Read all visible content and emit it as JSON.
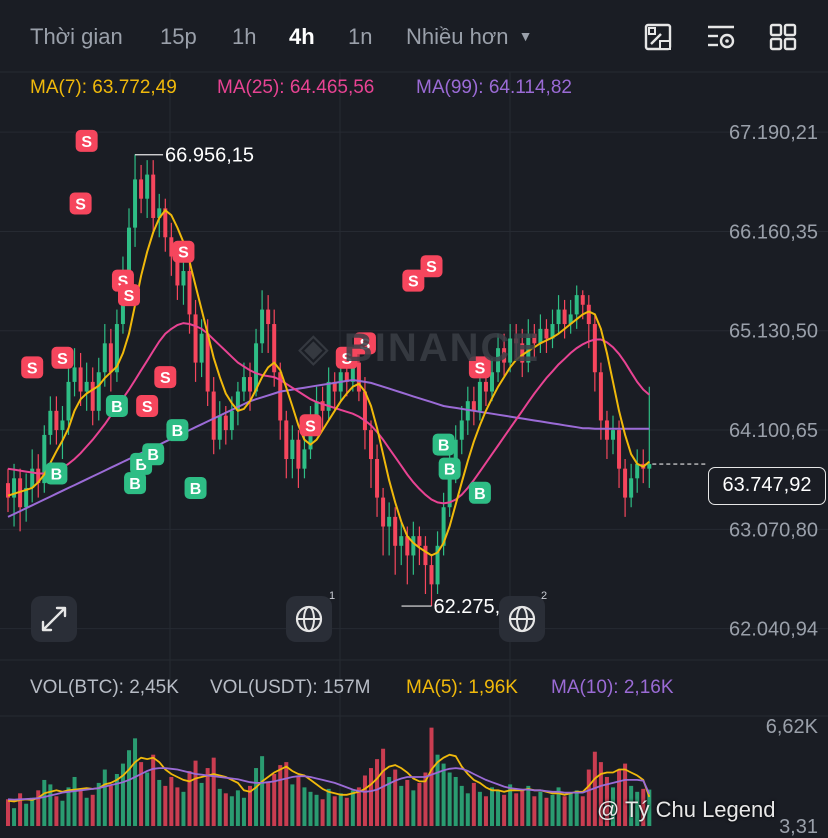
{
  "toolbar": {
    "timeframes": [
      "Thời gian",
      "15p",
      "1h",
      "4h",
      "1n",
      "Nhiều hơn"
    ],
    "active_timeframe": "4h",
    "icons": [
      "drawing-tools-icon",
      "indicator-settings-icon",
      "layout-grid-icon"
    ]
  },
  "legend": {
    "ma7": "MA(7): 63.772,49",
    "ma25": "MA(25): 64.465,56",
    "ma99": "MA(99): 64.114,82"
  },
  "volume_legend": {
    "vol_btc": "VOL(BTC): 2,45K",
    "vol_usdt": "VOL(USDT): 157M",
    "ma5": "MA(5): 1,96K",
    "ma10": "MA(10): 2,16K"
  },
  "colors": {
    "up": "#2ebd85",
    "down": "#f6465d",
    "ma7": "#f0b90b",
    "ma25": "#e84393",
    "ma99": "#9b6bd6",
    "background": "#1a1d24",
    "grid": "#262a32"
  },
  "watermark": {
    "brand": "BINANCE",
    "user": "@ Tý Chu Legend"
  },
  "current_price": "63.747,92",
  "event_badges": [
    "1",
    "2"
  ],
  "chart_data": {
    "type": "candlestick",
    "y_axis_ticks": [
      "67.190,21",
      "66.160,35",
      "65.130,50",
      "64.100,65",
      "63.070,80",
      "62.040,94"
    ],
    "ylim": [
      61840,
      67420
    ],
    "high_annotation": "66.956,15",
    "low_annotation": "62.275,00",
    "volume_axis_ticks": [
      "6,62K",
      "3,31"
    ],
    "vol_ylim": [
      0,
      7000
    ],
    "grid": true,
    "candles": [
      [
        63550,
        63400,
        63700,
        63250
      ],
      [
        63400,
        63600,
        63750,
        63100
      ],
      [
        63600,
        63300,
        63700,
        63050
      ],
      [
        63300,
        63500,
        63650,
        63150
      ],
      [
        63500,
        63700,
        63900,
        63350
      ],
      [
        63700,
        63550,
        63850,
        63400
      ],
      [
        63550,
        64050,
        64150,
        63450
      ],
      [
        64050,
        64300,
        64450,
        63950
      ],
      [
        64300,
        64100,
        64450,
        63950
      ],
      [
        64100,
        64200,
        64350,
        63800
      ],
      [
        64200,
        64600,
        64750,
        64050
      ],
      [
        64600,
        64750,
        64950,
        64450
      ],
      [
        64750,
        64500,
        64900,
        64350
      ],
      [
        64500,
        64600,
        64800,
        64300
      ],
      [
        64600,
        64300,
        64750,
        64150
      ],
      [
        64300,
        64700,
        64850,
        64200
      ],
      [
        64700,
        65000,
        65200,
        64550
      ],
      [
        65000,
        64700,
        65150,
        64500
      ],
      [
        64700,
        65200,
        65350,
        64600
      ],
      [
        65200,
        65700,
        65900,
        65100
      ],
      [
        65700,
        66200,
        66400,
        65500
      ],
      [
        66200,
        66700,
        66960,
        66000
      ],
      [
        66700,
        66500,
        66850,
        66350
      ],
      [
        66500,
        66750,
        66900,
        66300
      ],
      [
        66750,
        66300,
        66900,
        66150
      ],
      [
        66300,
        66400,
        66550,
        66100
      ],
      [
        66400,
        66100,
        66500,
        65950
      ],
      [
        66100,
        65900,
        66250,
        65700
      ],
      [
        65900,
        65600,
        66050,
        65450
      ],
      [
        65600,
        65750,
        65900,
        65400
      ],
      [
        65750,
        65300,
        65900,
        65100
      ],
      [
        65300,
        64800,
        65450,
        64600
      ],
      [
        64800,
        65100,
        65250,
        64650
      ],
      [
        65100,
        64500,
        65250,
        64350
      ],
      [
        64500,
        64000,
        64650,
        63850
      ],
      [
        64000,
        64250,
        64400,
        63900
      ],
      [
        64250,
        64100,
        64350,
        63950
      ],
      [
        64100,
        64300,
        64450,
        64000
      ],
      [
        64300,
        64500,
        64600,
        64150
      ],
      [
        64500,
        64650,
        64800,
        64400
      ],
      [
        64650,
        64500,
        64800,
        64300
      ],
      [
        64500,
        65000,
        65150,
        64450
      ],
      [
        65000,
        65350,
        65550,
        64900
      ],
      [
        65350,
        65200,
        65500,
        64900
      ],
      [
        65200,
        64700,
        65350,
        64550
      ],
      [
        64700,
        64200,
        64800,
        64000
      ],
      [
        64200,
        63800,
        64300,
        63600
      ],
      [
        63800,
        64000,
        64150,
        63600
      ],
      [
        64000,
        63700,
        64100,
        63500
      ],
      [
        63700,
        63900,
        64100,
        63600
      ],
      [
        63900,
        64200,
        64350,
        63800
      ],
      [
        64200,
        64400,
        64550,
        64050
      ],
      [
        64400,
        64300,
        64550,
        64100
      ],
      [
        64300,
        64600,
        64750,
        64200
      ],
      [
        64600,
        64500,
        64700,
        64300
      ],
      [
        64500,
        64700,
        64850,
        64400
      ],
      [
        64700,
        64600,
        64850,
        64450
      ],
      [
        64600,
        64800,
        64950,
        64500
      ],
      [
        64800,
        64500,
        64950,
        64400
      ],
      [
        64500,
        64100,
        64650,
        63900
      ],
      [
        64100,
        63800,
        64200,
        63500
      ],
      [
        63800,
        63400,
        63950,
        63200
      ],
      [
        63400,
        63100,
        63500,
        62800
      ],
      [
        63100,
        63200,
        63350,
        62800
      ],
      [
        63200,
        62900,
        63300,
        62600
      ],
      [
        62900,
        63000,
        63150,
        62700
      ],
      [
        63000,
        62800,
        63100,
        62500
      ],
      [
        62800,
        63000,
        63150,
        62600
      ],
      [
        63000,
        62900,
        63100,
        62700
      ],
      [
        62900,
        62700,
        63000,
        62400
      ],
      [
        62700,
        62500,
        62800,
        62275
      ],
      [
        62500,
        62900,
        63050,
        62400
      ],
      [
        62900,
        63300,
        63450,
        62800
      ],
      [
        63300,
        63700,
        63850,
        63200
      ],
      [
        63700,
        64000,
        64150,
        63550
      ],
      [
        64000,
        64200,
        64350,
        63850
      ],
      [
        64200,
        64400,
        64550,
        64050
      ],
      [
        64400,
        64300,
        64550,
        64150
      ],
      [
        64300,
        64600,
        64750,
        64200
      ],
      [
        64600,
        64500,
        64700,
        64350
      ],
      [
        64500,
        64700,
        64850,
        64400
      ],
      [
        64700,
        64950,
        65100,
        64600
      ],
      [
        64950,
        64800,
        65100,
        64650
      ],
      [
        64800,
        65050,
        65200,
        64700
      ],
      [
        65050,
        65000,
        65200,
        64850
      ],
      [
        65000,
        64800,
        65150,
        64650
      ],
      [
        64800,
        65100,
        65250,
        64700
      ],
      [
        65100,
        65000,
        65200,
        64850
      ],
      [
        65000,
        65150,
        65300,
        64900
      ],
      [
        65150,
        65050,
        65250,
        64900
      ],
      [
        65050,
        65200,
        65350,
        64950
      ],
      [
        65200,
        65350,
        65500,
        65100
      ],
      [
        65350,
        65200,
        65450,
        65050
      ],
      [
        65200,
        65300,
        65450,
        65100
      ],
      [
        65300,
        65500,
        65600,
        65150
      ],
      [
        65500,
        65400,
        65550,
        65250
      ],
      [
        65400,
        65200,
        65500,
        64950
      ],
      [
        65200,
        64700,
        65300,
        64500
      ],
      [
        64700,
        64200,
        64800,
        64000
      ],
      [
        64200,
        64000,
        64300,
        63800
      ],
      [
        64000,
        64100,
        64250,
        63850
      ],
      [
        64100,
        63700,
        64200,
        63500
      ],
      [
        63700,
        63400,
        63800,
        63200
      ],
      [
        63400,
        63600,
        63750,
        63300
      ],
      [
        63600,
        63750,
        63900,
        63450
      ],
      [
        63750,
        63700,
        63900,
        63550
      ],
      [
        63700,
        63748,
        64550,
        63500
      ]
    ],
    "ma7": [
      63420,
      63440,
      63460,
      63480,
      63500,
      63560,
      63640,
      63760,
      63880,
      63990,
      64120,
      64300,
      64420,
      64480,
      64520,
      64560,
      64640,
      64700,
      64760,
      64900,
      65100,
      65400,
      65700,
      65950,
      66150,
      66300,
      66380,
      66330,
      66200,
      66050,
      65850,
      65600,
      65350,
      65100,
      64850,
      64650,
      64480,
      64380,
      64300,
      64320,
      64400,
      64520,
      64650,
      64750,
      64800,
      64720,
      64540,
      64350,
      64150,
      64000,
      63950,
      64000,
      64100,
      64200,
      64300,
      64400,
      64480,
      64550,
      64580,
      64500,
      64350,
      64120,
      63850,
      63580,
      63350,
      63150,
      63000,
      62930,
      62880,
      62840,
      62800,
      62830,
      62930,
      63100,
      63330,
      63560,
      63780,
      63980,
      64150,
      64300,
      64430,
      64550,
      64650,
      64750,
      64830,
      64880,
      64920,
      64960,
      65000,
      65030,
      65060,
      65100,
      65150,
      65200,
      65250,
      65300,
      65330,
      65300,
      65150,
      64900,
      64600,
      64300,
      64050,
      63850,
      63750,
      63720,
      63772
    ],
    "ma25": [
      63700,
      63690,
      63680,
      63670,
      63660,
      63650,
      63650,
      63660,
      63680,
      63710,
      63750,
      63800,
      63860,
      63930,
      64000,
      64080,
      64160,
      64250,
      64340,
      64430,
      64520,
      64620,
      64720,
      64820,
      64920,
      65020,
      65100,
      65150,
      65190,
      65210,
      65200,
      65180,
      65150,
      65100,
      65040,
      64980,
      64920,
      64860,
      64800,
      64760,
      64720,
      64690,
      64670,
      64660,
      64650,
      64620,
      64580,
      64540,
      64500,
      64460,
      64420,
      64390,
      64370,
      64350,
      64330,
      64310,
      64290,
      64270,
      64240,
      64200,
      64150,
      64080,
      64000,
      63910,
      63820,
      63730,
      63640,
      63560,
      63490,
      63430,
      63380,
      63350,
      63340,
      63350,
      63380,
      63430,
      63500,
      63580,
      63670,
      63760,
      63850,
      63940,
      64030,
      64120,
      64210,
      64300,
      64390,
      64480,
      64560,
      64640,
      64710,
      64780,
      64840,
      64900,
      64950,
      64990,
      65020,
      65040,
      65040,
      65010,
      64960,
      64890,
      64800,
      64700,
      64600,
      64520,
      64466
    ],
    "ma99": [
      63200,
      63230,
      63260,
      63290,
      63320,
      63350,
      63380,
      63410,
      63440,
      63470,
      63500,
      63530,
      63560,
      63590,
      63620,
      63650,
      63680,
      63710,
      63740,
      63770,
      63800,
      63830,
      63860,
      63890,
      63920,
      63950,
      63980,
      64010,
      64040,
      64070,
      64100,
      64130,
      64160,
      64190,
      64220,
      64250,
      64280,
      64310,
      64340,
      64370,
      64400,
      64420,
      64440,
      64460,
      64480,
      64500,
      64510,
      64520,
      64530,
      64540,
      64550,
      64560,
      64570,
      64580,
      64590,
      64600,
      64610,
      64620,
      64610,
      64600,
      64590,
      64570,
      64550,
      64530,
      64510,
      64490,
      64470,
      64450,
      64430,
      64410,
      64390,
      64370,
      64350,
      64340,
      64330,
      64320,
      64310,
      64300,
      64290,
      64280,
      64270,
      64260,
      64250,
      64240,
      64230,
      64220,
      64210,
      64200,
      64190,
      64180,
      64170,
      64160,
      64150,
      64140,
      64130,
      64120,
      64120,
      64115,
      64115,
      64115,
      64115,
      64115,
      64115,
      64115,
      64115,
      64115,
      64115
    ],
    "volumes": [
      1800,
      1200,
      2200,
      1500,
      1900,
      2400,
      3100,
      2800,
      2000,
      1700,
      2600,
      3300,
      2500,
      1900,
      2100,
      2900,
      3800,
      2700,
      3500,
      4200,
      5100,
      5900,
      4300,
      3600,
      4800,
      3100,
      2700,
      3300,
      2600,
      2300,
      3700,
      4400,
      2900,
      3900,
      4600,
      2500,
      2200,
      2000,
      2400,
      1900,
      2700,
      3900,
      4700,
      3000,
      3500,
      4100,
      4300,
      2800,
      3300,
      2600,
      2300,
      2100,
      1800,
      2500,
      2000,
      2200,
      1900,
      2400,
      2600,
      3400,
      3900,
      4500,
      5200,
      3300,
      3800,
      2700,
      3100,
      2400,
      2900,
      3600,
      6620,
      4800,
      4200,
      3600,
      3300,
      2700,
      2200,
      2900,
      2300,
      2000,
      2600,
      2400,
      2100,
      2800,
      2200,
      2500,
      2700,
      2000,
      2300,
      1900,
      2100,
      2600,
      2000,
      2200,
      2400,
      2000,
      3800,
      5000,
      4300,
      3300,
      2600,
      3800,
      4200,
      2700,
      2300,
      2500,
      2450
    ],
    "vol_ma5": [
      1700,
      1650,
      1750,
      1800,
      1750,
      1900,
      2200,
      2300,
      2400,
      2300,
      2400,
      2450,
      2500,
      2550,
      2500,
      2550,
      2800,
      2900,
      3100,
      3400,
      3800,
      4300,
      4600,
      4500,
      4600,
      4300,
      3800,
      3500,
      3300,
      3100,
      3000,
      3200,
      3300,
      3400,
      3500,
      3400,
      3300,
      3100,
      2900,
      2400,
      2300,
      2600,
      3000,
      3300,
      3600,
      3800,
      4000,
      3700,
      3500,
      3400,
      3100,
      2800,
      2500,
      2300,
      2200,
      2100,
      2100,
      2200,
      2300,
      2500,
      2800,
      3200,
      3700,
      4000,
      4100,
      3900,
      3600,
      3200,
      3000,
      3000,
      3800,
      4300,
      4600,
      4800,
      4700,
      4000,
      3500,
      3100,
      2900,
      2600,
      2400,
      2400,
      2300,
      2400,
      2400,
      2400,
      2500,
      2400,
      2400,
      2300,
      2200,
      2200,
      2100,
      2200,
      2300,
      2300,
      2700,
      3200,
      3500,
      3600,
      3600,
      3800,
      3800,
      3600,
      3400,
      3100,
      1960
    ],
    "vol_ma10": [
      1800,
      1780,
      1800,
      1820,
      1840,
      1880,
      1950,
      2050,
      2150,
      2250,
      2300,
      2350,
      2400,
      2450,
      2500,
      2550,
      2650,
      2750,
      2850,
      2950,
      3100,
      3300,
      3500,
      3700,
      3850,
      3900,
      3900,
      3850,
      3800,
      3700,
      3600,
      3500,
      3450,
      3400,
      3350,
      3300,
      3250,
      3200,
      3150,
      3050,
      2950,
      2900,
      2900,
      2950,
      3000,
      3100,
      3200,
      3300,
      3350,
      3350,
      3300,
      3200,
      3100,
      3000,
      2900,
      2750,
      2600,
      2450,
      2350,
      2300,
      2350,
      2450,
      2650,
      2850,
      3050,
      3200,
      3300,
      3300,
      3300,
      3300,
      3450,
      3600,
      3750,
      3850,
      3900,
      3850,
      3700,
      3500,
      3300,
      3100,
      2950,
      2800,
      2650,
      2550,
      2500,
      2450,
      2450,
      2400,
      2400,
      2350,
      2300,
      2300,
      2250,
      2250,
      2250,
      2250,
      2400,
      2550,
      2700,
      2800,
      2900,
      3000,
      3100,
      3100,
      3100,
      3050,
      2160
    ],
    "markers": [
      {
        "i": 4,
        "type": "S",
        "price": 64750
      },
      {
        "i": 8,
        "type": "B",
        "price": 63650
      },
      {
        "i": 9,
        "type": "S",
        "price": 64850
      },
      {
        "i": 12,
        "type": "S",
        "price": 66450
      },
      {
        "i": 13,
        "type": "S",
        "price": 67100
      },
      {
        "i": 18,
        "type": "B",
        "price": 64350
      },
      {
        "i": 19,
        "type": "S",
        "price": 65650
      },
      {
        "i": 20,
        "type": "S",
        "price": 65500
      },
      {
        "i": 21,
        "type": "B",
        "price": 63550
      },
      {
        "i": 22,
        "type": "B",
        "price": 63750
      },
      {
        "i": 23,
        "type": "S",
        "price": 64350
      },
      {
        "i": 24,
        "type": "B",
        "price": 63850
      },
      {
        "i": 26,
        "type": "S",
        "price": 64650
      },
      {
        "i": 28,
        "type": "B",
        "price": 64100
      },
      {
        "i": 29,
        "type": "S",
        "price": 65950
      },
      {
        "i": 31,
        "type": "B",
        "price": 63500
      },
      {
        "i": 50,
        "type": "S",
        "price": 64150
      },
      {
        "i": 51,
        "type": "B",
        "price": 62200
      },
      {
        "i": 56,
        "type": "S",
        "price": 64850
      },
      {
        "i": 59,
        "type": "S",
        "price": 65000
      },
      {
        "i": 67,
        "type": "S",
        "price": 65650
      },
      {
        "i": 70,
        "type": "S",
        "price": 65800
      },
      {
        "i": 72,
        "type": "B",
        "price": 63950
      },
      {
        "i": 73,
        "type": "B",
        "price": 63700
      },
      {
        "i": 78,
        "type": "S",
        "price": 64750
      },
      {
        "i": 78,
        "type": "B",
        "price": 63450
      }
    ]
  }
}
